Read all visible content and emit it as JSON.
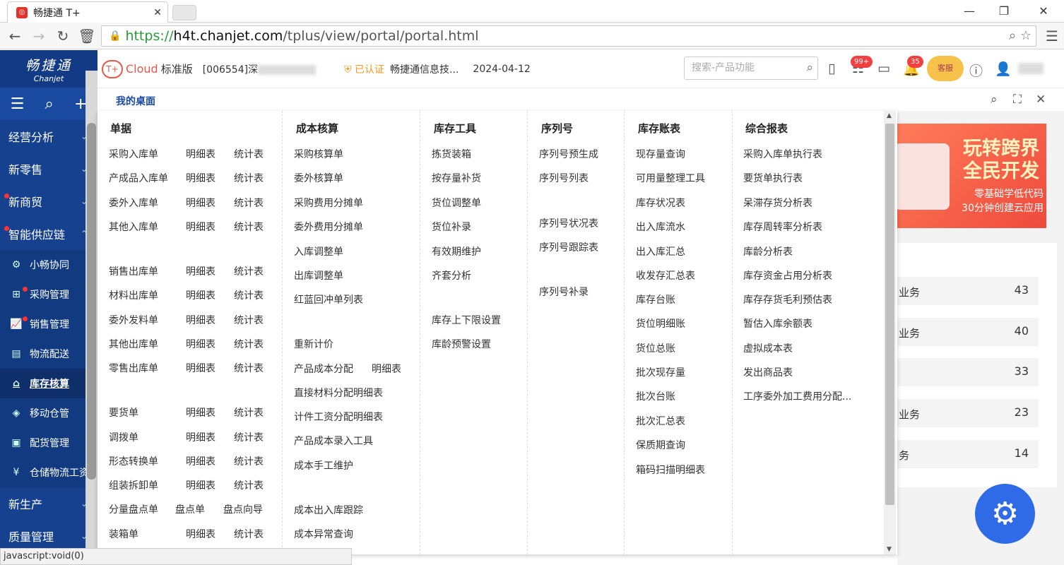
{
  "browser": {
    "tab_title": "畅捷通 T+",
    "url_green": "https://",
    "url_host": "h4t.chanjet.com",
    "url_path": "/tplus/view/portal/portal.html",
    "status": "javascript:void(0)"
  },
  "logo": {
    "cn": "畅捷通",
    "en": "Chanjet"
  },
  "header": {
    "cloud": "Cloud",
    "edition": "标准版",
    "account": "[006554]深",
    "cert": "已认证",
    "company": "畅捷通信息技...",
    "date": "2024-04-12",
    "search_placeholder": "搜索-产品功能",
    "badge_todo": "99+",
    "badge_notice": "35",
    "kefu": "客服"
  },
  "sidebar": {
    "items": [
      "经营分析",
      "新零售",
      "新商贸",
      "智能供应链"
    ],
    "subitems": [
      "小畅协同",
      "采购管理",
      "销售管理",
      "物流配送",
      "库存核算",
      "移动仓管",
      "配货管理",
      "仓储物流工资"
    ],
    "bottom": [
      "新生产",
      "质量管理"
    ]
  },
  "crumb": "我的桌面",
  "menu": {
    "c1": {
      "title": "单据",
      "rows": [
        [
          "采购入库单",
          "明细表",
          "统计表"
        ],
        [
          "产成品入库单",
          "明细表",
          "统计表"
        ],
        [
          "委外入库单",
          "明细表",
          "统计表"
        ],
        [
          "其他入库单",
          "明细表",
          "统计表"
        ],
        [
          "销售出库单",
          "明细表",
          "统计表"
        ],
        [
          "材料出库单",
          "明细表",
          "统计表"
        ],
        [
          "委外发料单",
          "明细表",
          "统计表"
        ],
        [
          "其他出库单",
          "明细表",
          "统计表"
        ],
        [
          "零售出库单",
          "明细表",
          "统计表"
        ],
        [
          "要货单",
          "明细表",
          "统计表"
        ],
        [
          "调拨单",
          "明细表",
          "统计表"
        ],
        [
          "形态转换单",
          "明细表",
          "统计表"
        ],
        [
          "组装拆卸单",
          "明细表",
          "统计表"
        ],
        [
          "分量盘点单",
          "盘点单",
          "盘点向导"
        ],
        [
          "装箱单",
          "明细表",
          "统计表"
        ]
      ]
    },
    "c2": {
      "title": "成本核算",
      "items": [
        "采购核算单",
        "委外核算单",
        "采购费用分摊单",
        "委外费用分摊单",
        "入库调整单",
        "出库调整单",
        "红蓝回冲单列表",
        "重新计价",
        "产品成本分配",
        "明细表",
        "直接材料分配明细表",
        "计件工资分配明细表",
        "产品成本录入工具",
        "成本手工维护",
        "成本出入库跟踪",
        "成本异常查询"
      ]
    },
    "c3": {
      "title": "库存工具",
      "items": [
        "拣货装箱",
        "按存量补货",
        "货位调整单",
        "货位补录",
        "有效期维护",
        "齐套分析",
        "库存上下限设置",
        "库龄预警设置"
      ]
    },
    "c4": {
      "title": "序列号",
      "items": [
        "序列号预生成",
        "序列号列表",
        "序列号状况表",
        "序列号跟踪表",
        "序列号补录"
      ]
    },
    "c5": {
      "title": "库存账表",
      "items": [
        "现存量查询",
        "可用量整理工具",
        "库存状况表",
        "出入库流水",
        "出入库汇总",
        "收发存汇总表",
        "库存台账",
        "货位明细账",
        "货位总账",
        "批次现存量",
        "批次台账",
        "批次汇总表",
        "保质期查询",
        "箱码扫描明细表"
      ]
    },
    "c6": {
      "title": "综合报表",
      "items": [
        "采购入库单执行表",
        "要货单执行表",
        "呆滞存货分析表",
        "库存周转率分析表",
        "库龄分析表",
        "库存资金占用分析表",
        "库存存货毛利预估表",
        "暂估入库余额表",
        "虚拟成本表",
        "发出商品表",
        "工序委外加工费用分配..."
      ]
    }
  },
  "banner": {
    "line1": "玩转跨界",
    "line2": "全民开发",
    "line3": "零基础学低代码",
    "line4": "30分钟创建云应用"
  },
  "stats": [
    {
      "label": "业务",
      "value": "43"
    },
    {
      "label": "业务",
      "value": "40"
    },
    {
      "label": "",
      "value": "33"
    },
    {
      "label": "业务",
      "value": "23"
    },
    {
      "label": "务",
      "value": "14"
    }
  ]
}
